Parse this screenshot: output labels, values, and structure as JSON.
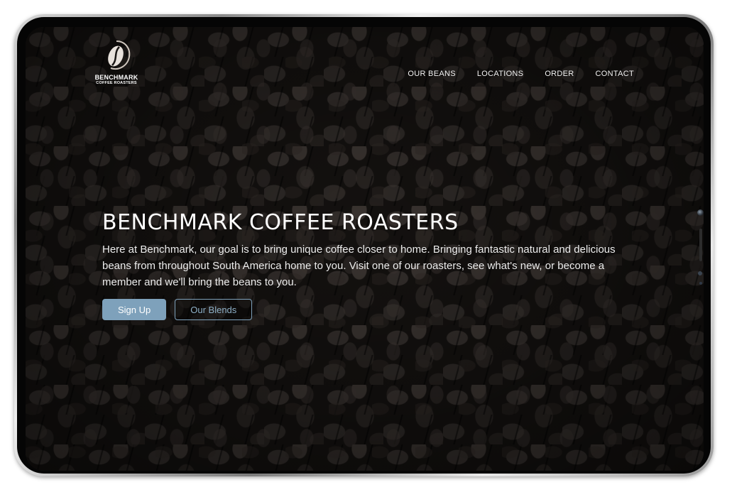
{
  "brand": {
    "name": "BENCHMARK",
    "tagline": "COFFEE ROASTERS"
  },
  "nav": {
    "items": [
      "OUR BEANS",
      "LOCATIONS",
      "ORDER",
      "CONTACT"
    ]
  },
  "hero": {
    "title": "BENCHMARK COFFEE ROASTERS",
    "text": "Here at Benchmark, our goal is to bring unique coffee closer to home. Bringing fantastic natural and delicious beans from throughout South America home to you. Visit one of our roasters, see what's new, or become a member and we'll bring the beans to you.",
    "primary_button": "Sign Up",
    "secondary_button": "Our Blends"
  },
  "colors": {
    "accent": "#7ea1bb",
    "background": "#171412",
    "text": "#ffffff"
  },
  "icons": {
    "logo": "coffee-bean-icon",
    "camera": "camera-icon"
  }
}
